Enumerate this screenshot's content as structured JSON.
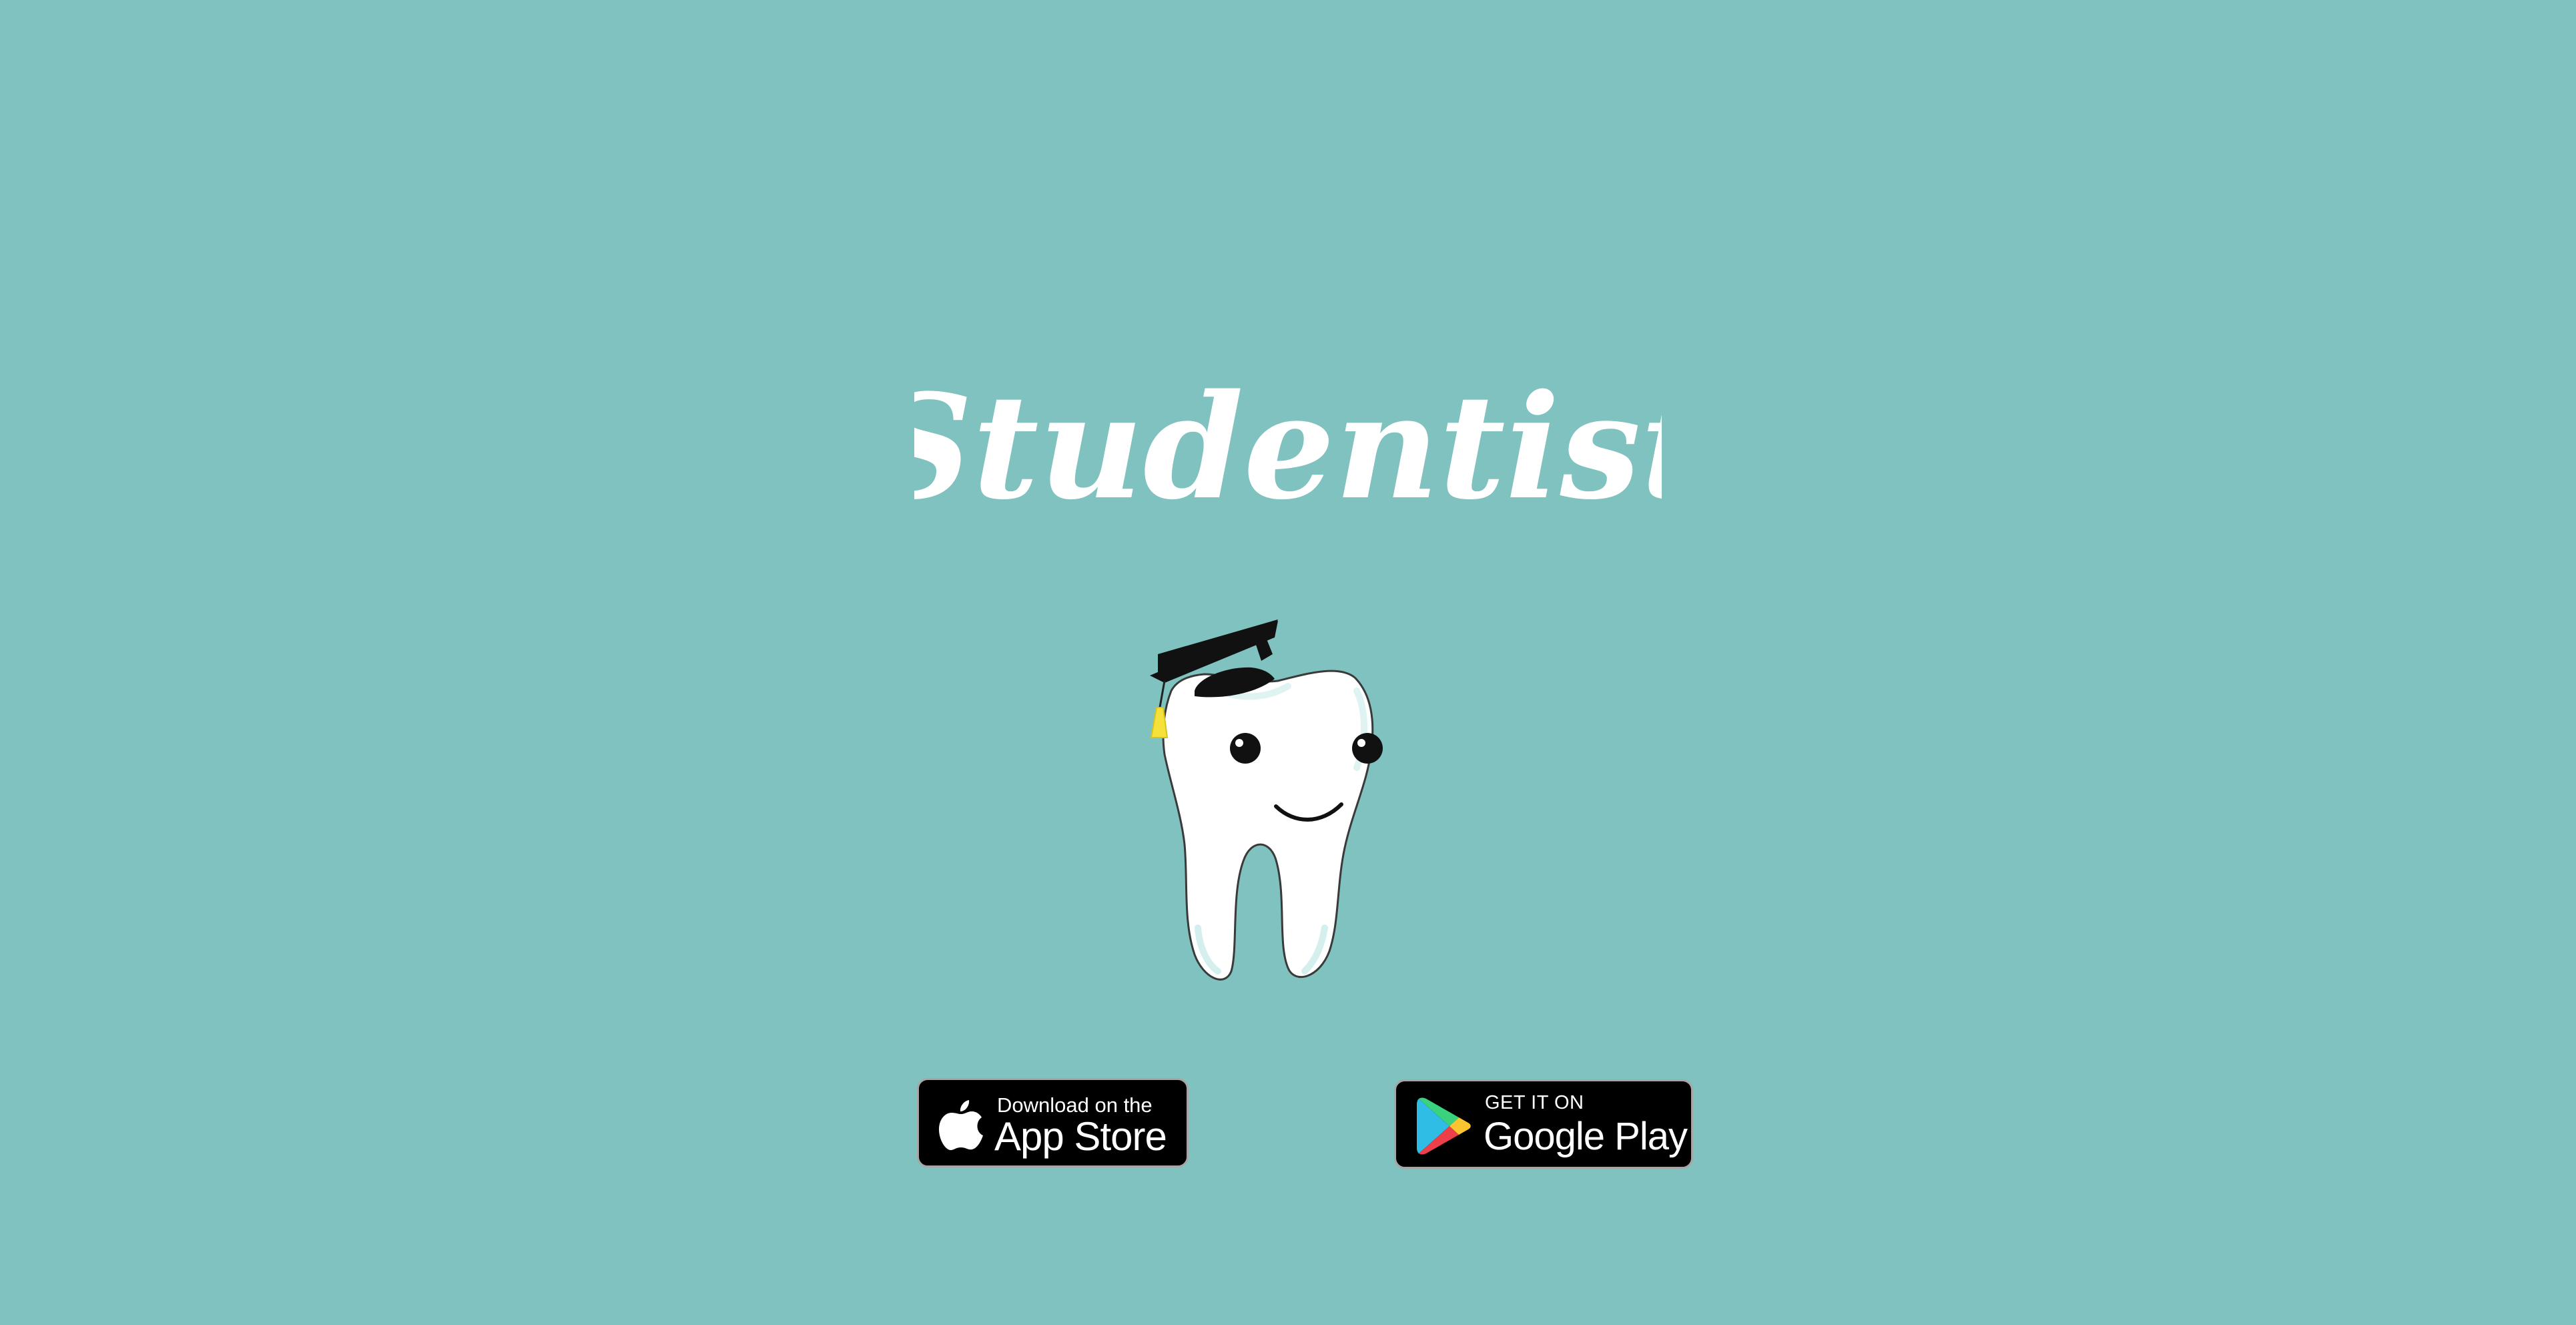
{
  "app": {
    "logo_text": "Studentist"
  },
  "mascot": {
    "icon": "graduate-tooth-icon"
  },
  "store_badges": {
    "app_store": {
      "small_label": "Download on the",
      "big_label": "App Store",
      "icon": "apple-icon"
    },
    "google_play": {
      "small_label": "GET IT ON",
      "big_label": "Google Play",
      "icon": "google-play-icon"
    }
  },
  "colors": {
    "background": "#7fc2bf",
    "logo": "#ffffff",
    "badge_background": "#000000",
    "tassel": "#f5e13a"
  }
}
